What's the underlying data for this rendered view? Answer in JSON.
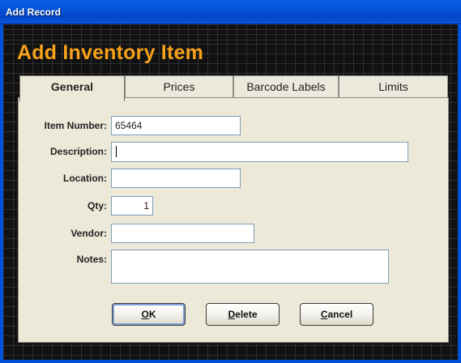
{
  "window": {
    "title": "Add Record"
  },
  "heading": "Add Inventory Item",
  "tabs": [
    {
      "label": "General",
      "active": true
    },
    {
      "label": "Prices",
      "active": false
    },
    {
      "label": "Barcode Labels",
      "active": false
    },
    {
      "label": "Limits",
      "active": false
    }
  ],
  "form": {
    "item_number": {
      "label": "Item Number:",
      "value": "65464"
    },
    "description": {
      "label": "Description:",
      "value": ""
    },
    "location": {
      "label": "Location:",
      "value": ""
    },
    "qty": {
      "label": "Qty:",
      "value": "1"
    },
    "vendor": {
      "label": "Vendor:",
      "value": ""
    },
    "notes": {
      "label": "Notes:",
      "value": ""
    }
  },
  "buttons": {
    "ok": {
      "hotkey": "O",
      "rest": "K"
    },
    "delete": {
      "hotkey": "D",
      "rest": "elete"
    },
    "cancel": {
      "hotkey": "C",
      "rest": "ancel"
    }
  },
  "colors": {
    "titlebar": "#0553d8",
    "heading": "#f7a21b",
    "panel": "#ece9d8",
    "background": "#111111"
  }
}
